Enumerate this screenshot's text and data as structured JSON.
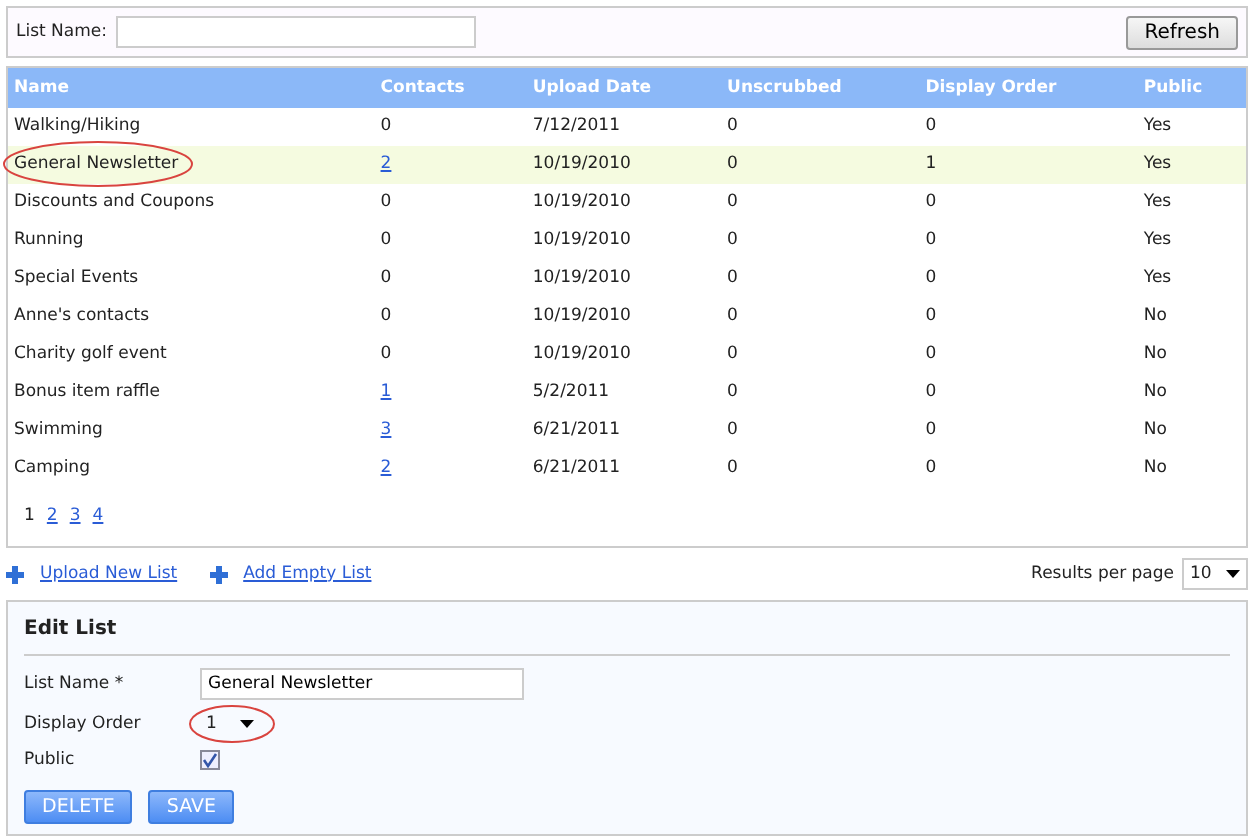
{
  "filter": {
    "label": "List Name:",
    "button": "Refresh"
  },
  "table": {
    "columns": [
      "Name",
      "Contacts",
      "Upload Date",
      "Unscrubbed",
      "Display Order",
      "Public"
    ],
    "rows": [
      {
        "name": "Walking/Hiking",
        "contacts": "0",
        "contacts_link": false,
        "upload_date": "7/12/2011",
        "unscrubbed": "0",
        "display_order": "0",
        "public": "Yes",
        "selected": false,
        "circled": false
      },
      {
        "name": "General Newsletter",
        "contacts": "2",
        "contacts_link": true,
        "upload_date": "10/19/2010",
        "unscrubbed": "0",
        "display_order": "1",
        "public": "Yes",
        "selected": true,
        "circled": true
      },
      {
        "name": "Discounts and Coupons",
        "contacts": "0",
        "contacts_link": false,
        "upload_date": "10/19/2010",
        "unscrubbed": "0",
        "display_order": "0",
        "public": "Yes",
        "selected": false,
        "circled": false
      },
      {
        "name": "Running",
        "contacts": "0",
        "contacts_link": false,
        "upload_date": "10/19/2010",
        "unscrubbed": "0",
        "display_order": "0",
        "public": "Yes",
        "selected": false,
        "circled": false
      },
      {
        "name": "Special Events",
        "contacts": "0",
        "contacts_link": false,
        "upload_date": "10/19/2010",
        "unscrubbed": "0",
        "display_order": "0",
        "public": "Yes",
        "selected": false,
        "circled": false
      },
      {
        "name": "Anne's contacts",
        "contacts": "0",
        "contacts_link": false,
        "upload_date": "10/19/2010",
        "unscrubbed": "0",
        "display_order": "0",
        "public": "No",
        "selected": false,
        "circled": false
      },
      {
        "name": "Charity golf event",
        "contacts": "0",
        "contacts_link": false,
        "upload_date": "10/19/2010",
        "unscrubbed": "0",
        "display_order": "0",
        "public": "No",
        "selected": false,
        "circled": false
      },
      {
        "name": "Bonus item raffle",
        "contacts": "1",
        "contacts_link": true,
        "upload_date": "5/2/2011",
        "unscrubbed": "0",
        "display_order": "0",
        "public": "No",
        "selected": false,
        "circled": false
      },
      {
        "name": "Swimming",
        "contacts": "3",
        "contacts_link": true,
        "upload_date": "6/21/2011",
        "unscrubbed": "0",
        "display_order": "0",
        "public": "No",
        "selected": false,
        "circled": false
      },
      {
        "name": "Camping",
        "contacts": "2",
        "contacts_link": true,
        "upload_date": "6/21/2011",
        "unscrubbed": "0",
        "display_order": "0",
        "public": "No",
        "selected": false,
        "circled": false
      }
    ]
  },
  "pagination": [
    {
      "label": "1",
      "selected": true
    },
    {
      "label": "2",
      "selected": false
    },
    {
      "label": "3",
      "selected": false
    },
    {
      "label": "4",
      "selected": false
    }
  ],
  "actions": [
    "Upload New List",
    "Add Empty List"
  ],
  "results_per_page": {
    "label": "Results per page",
    "value": "10"
  },
  "edit_list": {
    "title": "Edit List",
    "list_name": {
      "label": "List Name *",
      "value": "General Newsletter"
    },
    "display_order": {
      "label": "Display Order",
      "value": "1",
      "circled": true
    },
    "public": {
      "label": "Public",
      "checked": true
    },
    "buttons": [
      "DELETE",
      "SAVE"
    ]
  }
}
